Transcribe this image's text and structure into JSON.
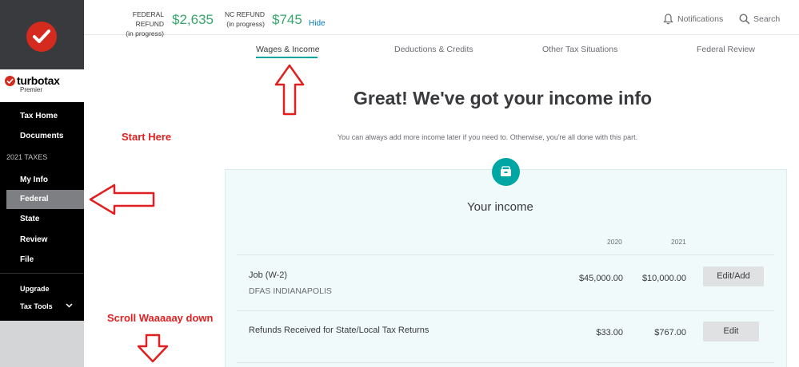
{
  "sidebar": {
    "brand": {
      "name": "turbotax",
      "edition": "Premier"
    },
    "items": [
      {
        "label": "Tax Home"
      },
      {
        "label": "Documents"
      },
      {
        "label": "My Info"
      },
      {
        "label": "Federal",
        "active": true
      },
      {
        "label": "State"
      },
      {
        "label": "Review"
      },
      {
        "label": "File"
      },
      {
        "label": "Upgrade"
      },
      {
        "label": "Tax Tools"
      }
    ],
    "section_heading": "2021 TAXES"
  },
  "header": {
    "federal": {
      "label": "FEDERAL REFUND",
      "status": "(in progress)",
      "amount": "$2,635"
    },
    "state": {
      "label": "NC REFUND",
      "status": "(in progress)",
      "amount": "$745"
    },
    "hide_label": "Hide",
    "notifications_label": "Notifications",
    "search_label": "Search"
  },
  "tabs": [
    {
      "label": "Wages & Income",
      "active": true
    },
    {
      "label": "Deductions & Credits"
    },
    {
      "label": "Other Tax Situations"
    },
    {
      "label": "Federal Review"
    }
  ],
  "main": {
    "title": "Great! We've got your income info",
    "subtitle": "You can always add more income later if you need to. Otherwise, you're all done with this part.",
    "card_title": "Your income",
    "years": [
      "2020",
      "2021"
    ],
    "rows": [
      {
        "title": "Job (W-2)",
        "subtitle": "DFAS INDIANAPOLIS",
        "amount_2020": "$45,000.00",
        "amount_2021": "$10,000.00",
        "action": "Edit/Add"
      },
      {
        "title": "Refunds Received for State/Local Tax Returns",
        "amount_2020": "$33.00",
        "amount_2021": "$767.00",
        "action": "Edit"
      }
    ]
  },
  "annotations": {
    "start_here": "Start Here",
    "scroll_down": "Scroll Waaaaay down"
  },
  "colors": {
    "accent_teal": "#00a6a4",
    "refund_green": "#37a56d",
    "brand_red": "#d52b1e",
    "annotation_red": "#e02020"
  }
}
